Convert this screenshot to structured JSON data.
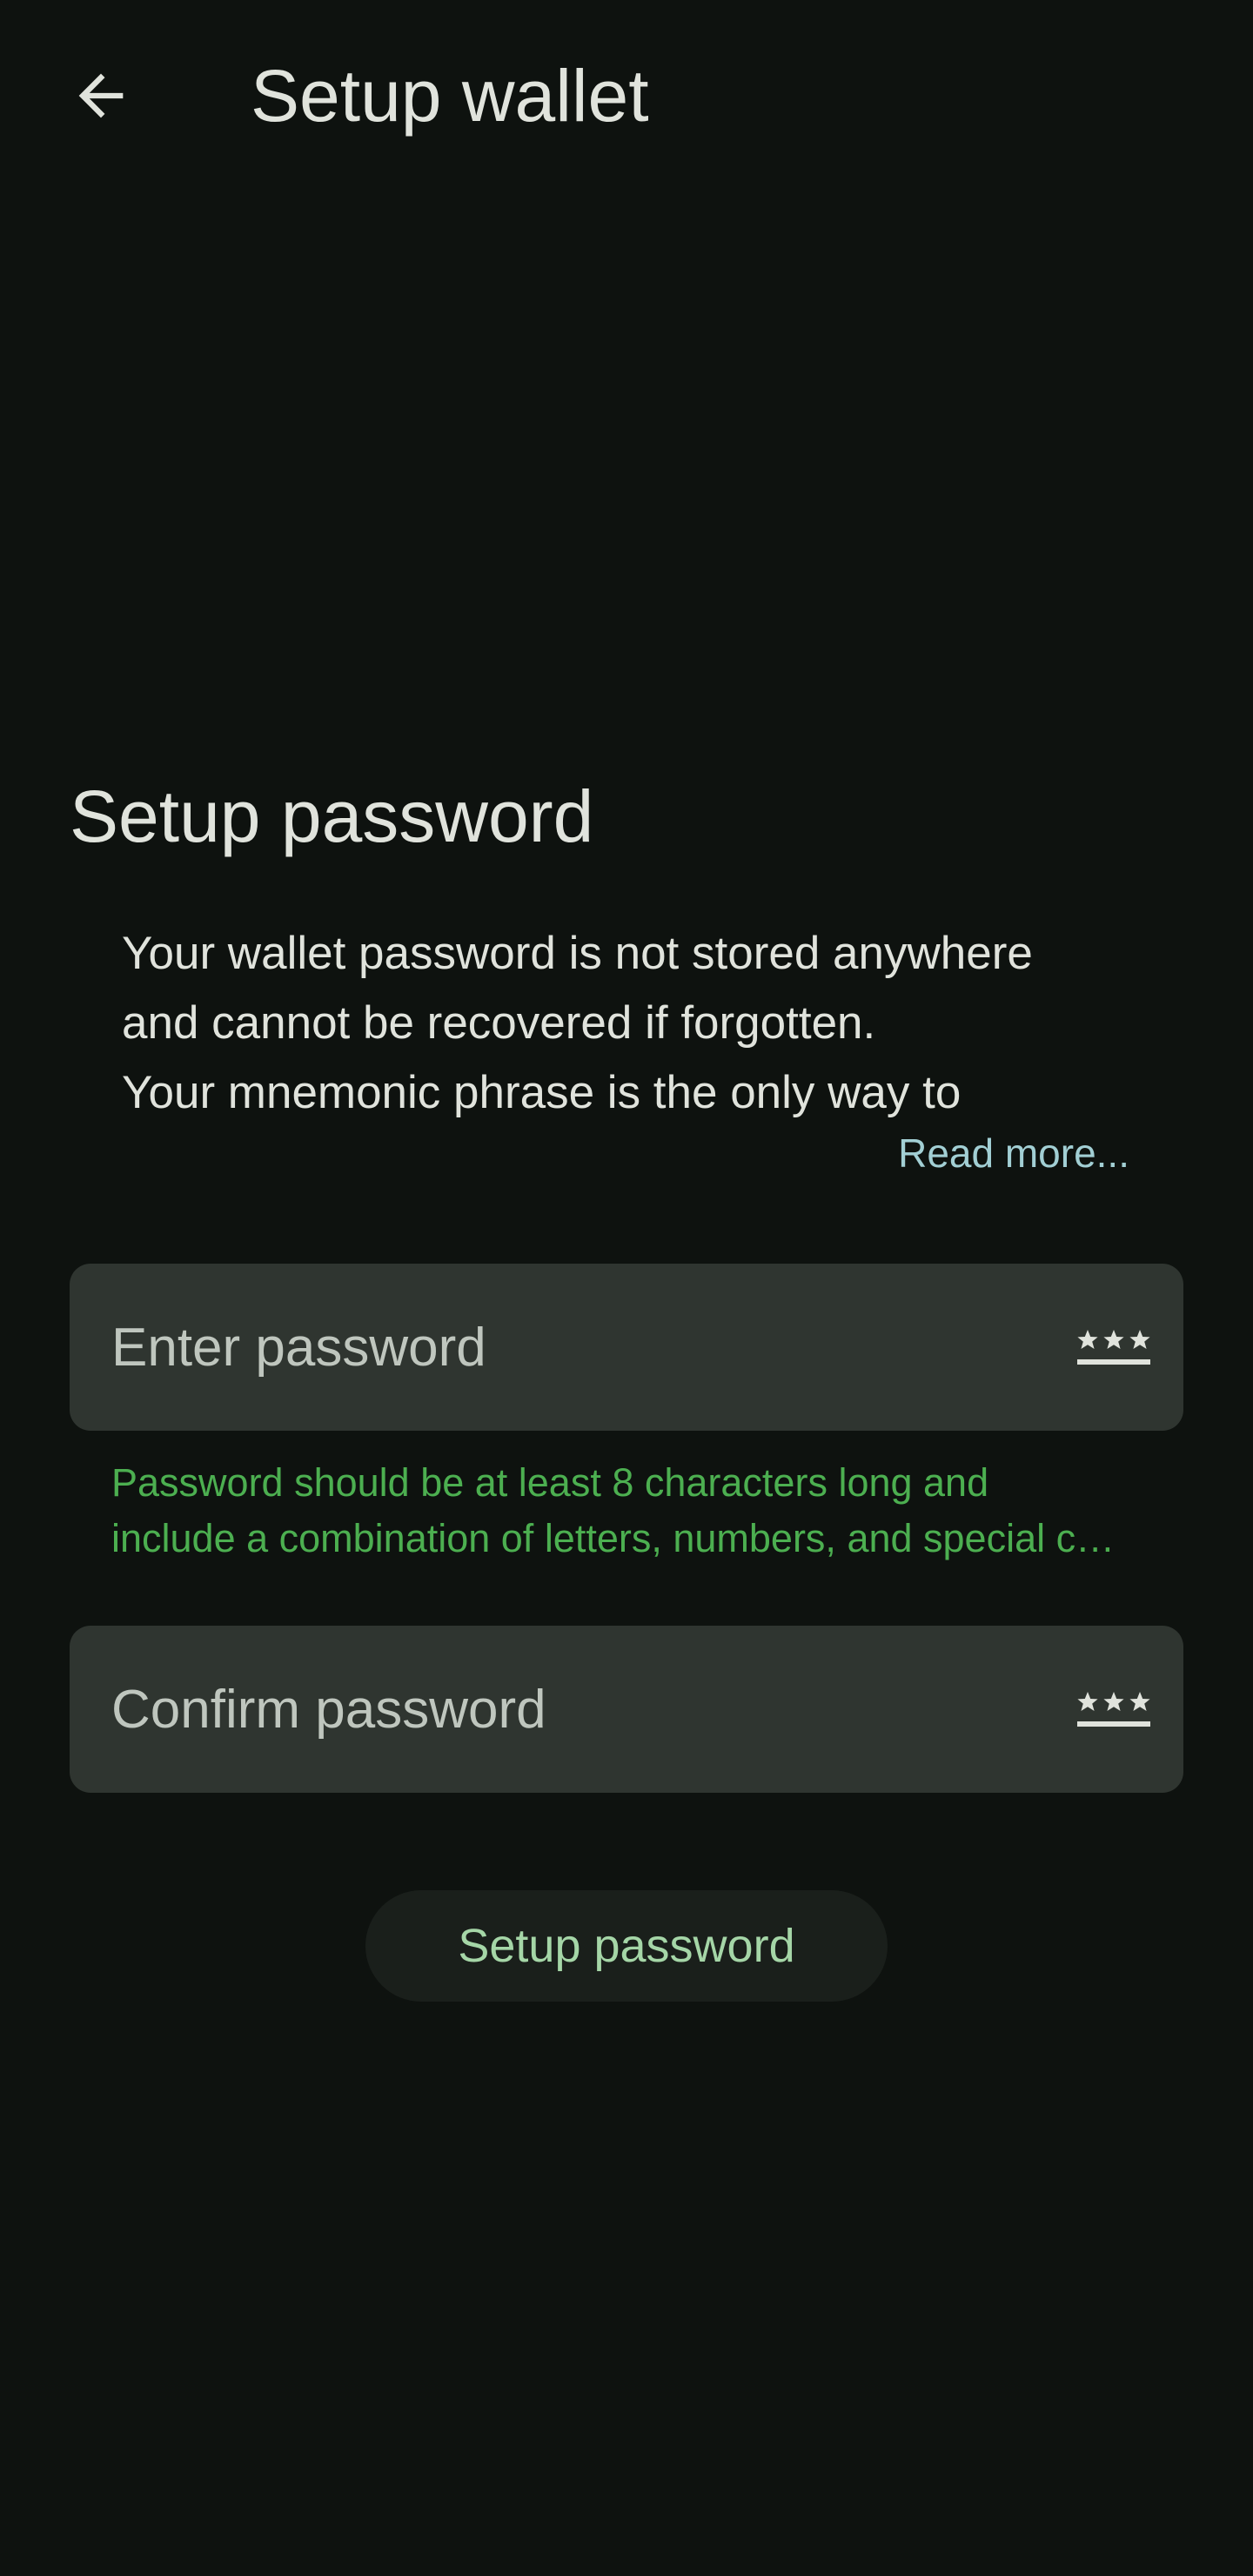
{
  "header": {
    "back_icon": "arrow-left-icon",
    "title": "Setup wallet"
  },
  "section": {
    "title": "Setup password",
    "info_lines": [
      "Your wallet password is not stored anywhere",
      "and cannot be recovered if forgotten.",
      "Your mnemonic phrase is the only way to"
    ],
    "read_more": "Read more..."
  },
  "fields": {
    "enter_password": {
      "placeholder": "Enter password",
      "value": "",
      "icon": "password-mask-icon"
    },
    "confirm_password": {
      "placeholder": "Confirm password",
      "value": "",
      "icon": "password-mask-icon"
    }
  },
  "hint": {
    "lines": [
      "Password should be at least 8 characters long and",
      "include a combination of letters, numbers, and special characters"
    ]
  },
  "actions": {
    "submit_label": "Setup password"
  },
  "colors": {
    "background": "#0e120f",
    "surface_field": "#2f3530",
    "text_primary": "#e0e3dc",
    "text_placeholder": "#bfc6be",
    "link": "#a2cfd4",
    "hint_green": "#4caf50",
    "button_text": "#a5d6a7",
    "button_bg": "#1a1f1b"
  }
}
